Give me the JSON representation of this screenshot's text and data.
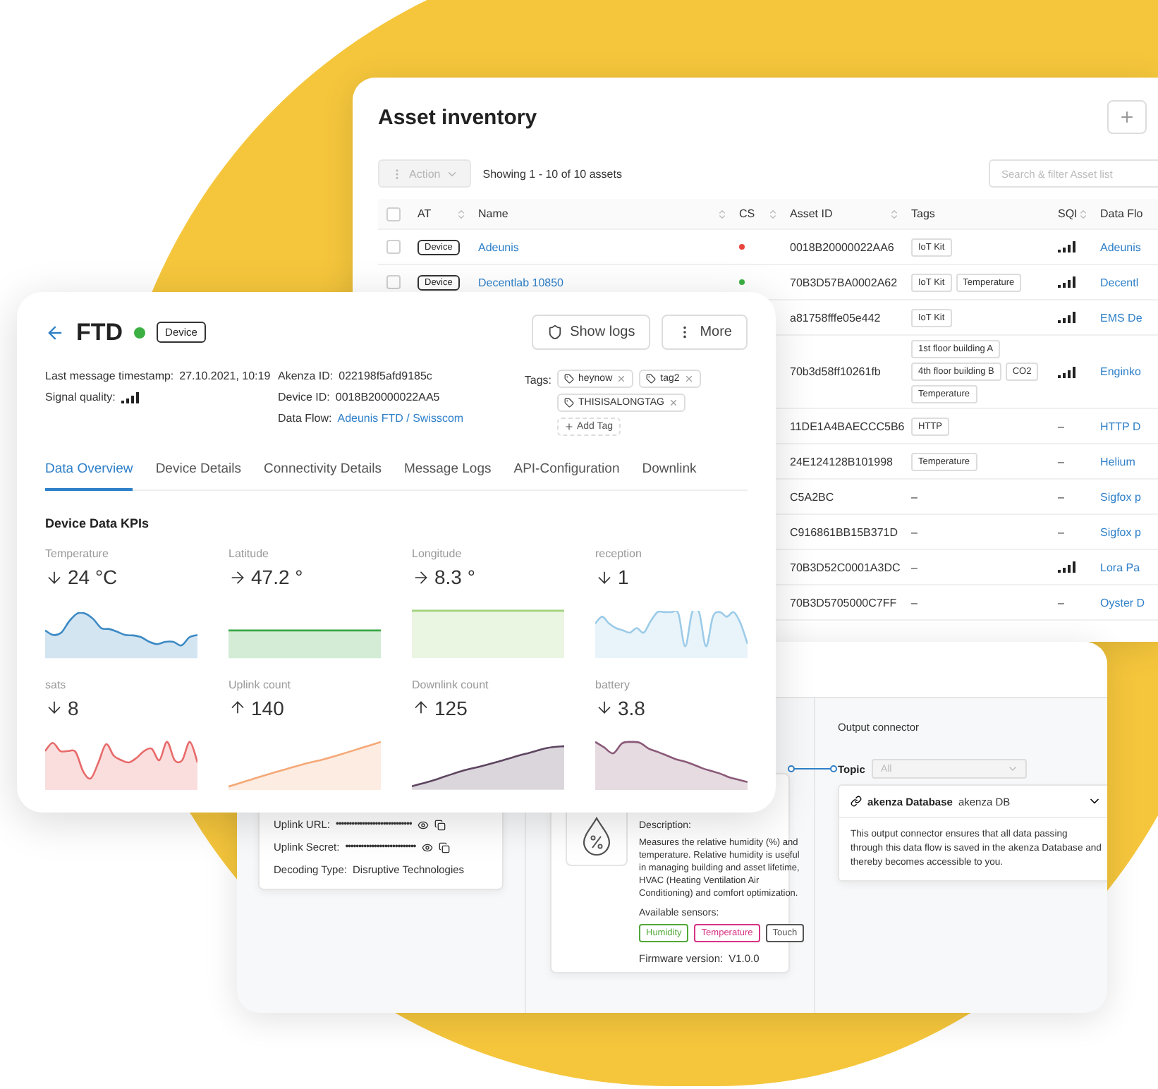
{
  "asset_inventory": {
    "title": "Asset inventory",
    "action_button": {
      "label": "Action",
      "disabled": true
    },
    "showing": "Showing 1 - 10 of 10 assets",
    "search": {
      "placeholder": "Search & filter Asset list"
    },
    "header_checkbox": {
      "checked": false
    },
    "columns": [
      "AT",
      "Name",
      "CS",
      "Asset ID",
      "Tags",
      "SQI",
      "Data Flo"
    ],
    "rows": [
      {
        "checked": false,
        "type": "Device",
        "name": "Adeunis",
        "color": "#e8453c",
        "asset_id": "0018B20000022AA6",
        "tags": {
          "kind": "chips",
          "items": [
            "IoT Kit"
          ]
        },
        "sqi": {
          "kind": "signal"
        },
        "data_flow": "Adeunis"
      },
      {
        "checked": false,
        "type": "Device",
        "name": "Decentlab 10850",
        "color": "#3cb043",
        "asset_id": "70B3D57BA0002A62",
        "tags": {
          "kind": "chips",
          "items": [
            "IoT Kit",
            "Temperature"
          ]
        },
        "sqi": {
          "kind": "signal"
        },
        "data_flow": "Decentl"
      },
      {
        "asset_id": "a81758fffe05e442",
        "tags": {
          "kind": "chips",
          "items": [
            "IoT Kit"
          ]
        },
        "sqi": {
          "kind": "signal"
        },
        "data_flow": "EMS De"
      },
      {
        "asset_id": "70b3d58ff10261fb",
        "tags": {
          "kind": "chips",
          "items": [
            "1st floor building A",
            "4th floor building B",
            "CO2",
            "Temperature"
          ]
        },
        "sqi": {
          "kind": "signal"
        },
        "data_flow": "Enginko"
      },
      {
        "asset_id": "11DE1A4BAECCC5B6",
        "tags": {
          "kind": "chips",
          "items": [
            "HTTP"
          ]
        },
        "sqi": {
          "kind": "text",
          "text": "–"
        },
        "data_flow": "HTTP D"
      },
      {
        "asset_id": "24E124128B101998",
        "tags": {
          "kind": "chips",
          "items": [
            "Temperature"
          ]
        },
        "sqi": {
          "kind": "text",
          "text": "–"
        },
        "data_flow": "Helium"
      },
      {
        "asset_id": "C5A2BC",
        "tags": {
          "kind": "text",
          "text": "–"
        },
        "sqi": {
          "kind": "text",
          "text": "–"
        },
        "data_flow": "Sigfox p"
      },
      {
        "asset_id": "C916861BB15B371D",
        "tags": {
          "kind": "text",
          "text": "–"
        },
        "sqi": {
          "kind": "text",
          "text": "–"
        },
        "data_flow": "Sigfox p"
      },
      {
        "asset_id": "70B3D52C0001A3DC",
        "tags": {
          "kind": "text",
          "text": "–"
        },
        "sqi": {
          "kind": "signal"
        },
        "data_flow": "Lora Pa"
      },
      {
        "asset_id": "70B3D5705000C7FF",
        "tags": {
          "kind": "text",
          "text": "–"
        },
        "sqi": {
          "kind": "text",
          "text": "–"
        },
        "data_flow": "Oyster D"
      }
    ]
  },
  "device": {
    "name": "FTD",
    "status": {
      "color": "#3cb043"
    },
    "type": "Device",
    "buttons": [
      {
        "kind": "logs",
        "label": "Show logs"
      },
      {
        "kind": "more",
        "label": "More"
      }
    ],
    "info_columns": [
      [
        {
          "kind": "text",
          "label": "Last message timestamp:",
          "value": "27.10.2021, 10:19"
        },
        {
          "kind": "signal",
          "label": "Signal quality:"
        }
      ],
      [
        {
          "kind": "text",
          "label": "Akenza ID:",
          "value": "022198f5afd9185c"
        },
        {
          "kind": "text",
          "label": "Device ID:",
          "value": "0018B20000022AA5"
        },
        {
          "kind": "link",
          "label": "Data Flow:",
          "value": "Adeunis FTD / Swisscom"
        }
      ]
    ],
    "tags": {
      "label": "Tags:",
      "items": [
        "heynow",
        "tag2",
        "THISISALONGTAG"
      ],
      "add_label": "Add Tag"
    },
    "tabs": [
      {
        "label": "Data Overview",
        "selected": true
      },
      {
        "label": "Device Details",
        "selected": false
      },
      {
        "label": "Connectivity Details",
        "selected": false
      },
      {
        "label": "Message Logs",
        "selected": false
      },
      {
        "label": "API-Configuration",
        "selected": false
      },
      {
        "label": "Downlink",
        "selected": false
      }
    ],
    "kpi_title": "Device Data KPIs",
    "kpis": [
      {
        "label": "Temperature",
        "value": "24 °C",
        "kind": "down",
        "color": "#3d8ac4"
      },
      {
        "label": "Latitude",
        "value": "47.2 °",
        "kind": "right",
        "color": "#3aa845"
      },
      {
        "label": "Longitude",
        "value": "8.3 °",
        "kind": "right",
        "color": "#9fd27a"
      },
      {
        "label": "reception",
        "value": "1",
        "kind": "down",
        "color": "#9ccbe8"
      },
      {
        "label": "sats",
        "value": "8",
        "kind": "down",
        "color": "#e86a6a"
      },
      {
        "label": "Uplink count",
        "value": "140",
        "kind": "up",
        "color": "#f5a877"
      },
      {
        "label": "Downlink count",
        "value": "125",
        "kind": "up",
        "color": "#5d4560"
      },
      {
        "label": "battery",
        "value": "3.8",
        "kind": "down",
        "color": "#8a5a78"
      }
    ]
  },
  "data_flow_editor": {
    "connectivity": {
      "fields": [
        {
          "kind": "secret",
          "label": "Uplink URL:",
          "value": "•••••••••••••••••••••••••••••"
        },
        {
          "kind": "secret",
          "label": "Uplink Secret:",
          "value": "•••••••••••••••••••••••••••"
        },
        {
          "kind": "text",
          "label": "Decoding Type:",
          "value": "Disruptive Technologies"
        }
      ]
    },
    "device_type": {
      "description_label": "Description:",
      "description": "Measures the relative humidity (%) and temperature. Relative humidity is useful in managing building and asset lifetime, HVAC (Heating Ventilation Air Conditioning) and comfort optimization.",
      "sensors_label": "Available sensors:",
      "sensors": [
        {
          "label": "Humidity",
          "color": "#52a83a"
        },
        {
          "label": "Temperature",
          "color": "#d63384"
        },
        {
          "label": "Touch",
          "color": "#555555"
        }
      ],
      "firmware_label": "Firmware version:",
      "firmware": "V1.0.0"
    },
    "output": {
      "title": "Output connector",
      "topic": {
        "label": "Topic",
        "value": "All",
        "disabled": true
      },
      "connector": {
        "name": "akenza Database",
        "subtitle": "akenza DB",
        "text": "This output connector ensures that all data passing through this data flow is saved in the akenza Database and thereby becomes accessible to you."
      }
    }
  }
}
